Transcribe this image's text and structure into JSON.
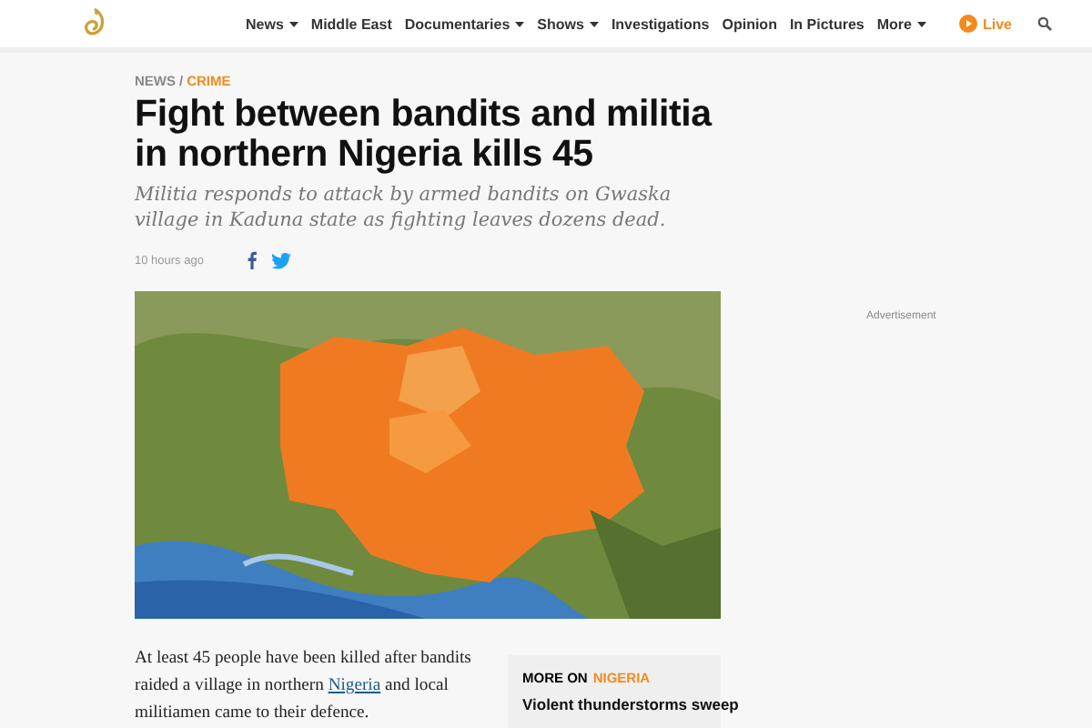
{
  "nav": [
    {
      "label": "News",
      "dropdown": true
    },
    {
      "label": "Middle East",
      "dropdown": false
    },
    {
      "label": "Documentaries",
      "dropdown": true
    },
    {
      "label": "Shows",
      "dropdown": true
    },
    {
      "label": "Investigations",
      "dropdown": false
    },
    {
      "label": "Opinion",
      "dropdown": false
    },
    {
      "label": "In Pictures",
      "dropdown": false
    },
    {
      "label": "More",
      "dropdown": true
    }
  ],
  "live": "Live",
  "breadcrumb": [
    "NEWS",
    "CRIME"
  ],
  "breadcrumb_separator": "/",
  "headline": "Fight between bandits and militia in northern Nigeria kills 45",
  "summary": "Militia responds to attack by armed bandits on Gwaska village in Kaduna state as fighting leaves dozens dead.",
  "time": "10 hours ago",
  "image": {
    "kind": "picture"
  },
  "body": [
    {
      "kind": "text",
      "text": "At least 45 people have been killed after bandits raided a village in northern"
    },
    {
      "kind": "link",
      "text": "Nigeria"
    },
    {
      "kind": "text",
      "text": "and local militiamen came to their defence."
    }
  ],
  "advertisement": "Advertisement",
  "more_on": {
    "label": "MORE ON",
    "topic": "NIGERIA",
    "items": [
      "Violent thunderstorms sweep"
    ]
  }
}
